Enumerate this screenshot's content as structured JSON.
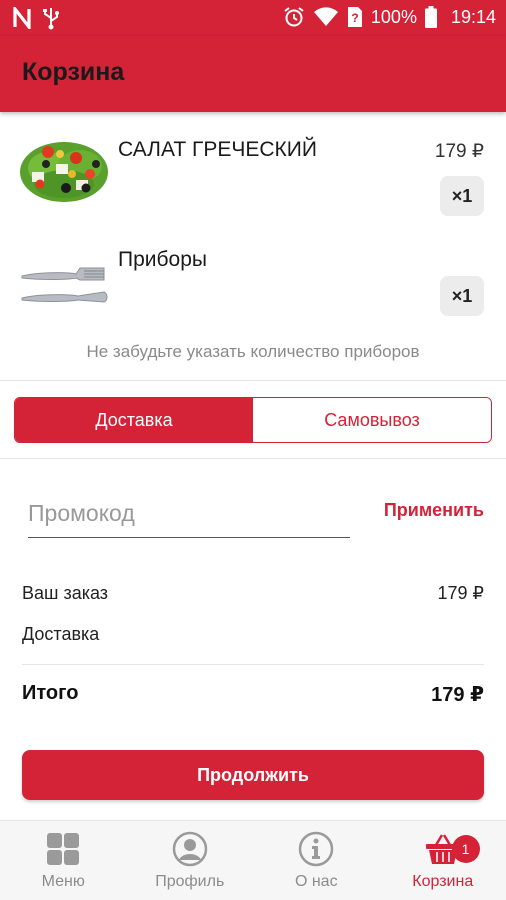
{
  "status_bar": {
    "battery_text": "100%",
    "time": "19:14",
    "icons": [
      "n-icon",
      "usb-icon",
      "alarm-icon",
      "wifi-icon",
      "sim-question-icon",
      "battery-icon"
    ]
  },
  "app_bar": {
    "title": "Корзина"
  },
  "cart_items": [
    {
      "name": "САЛАТ ГРЕЧЕСКИЙ",
      "price": "179 ₽",
      "qty": "×1",
      "image": "greek-salad-photo"
    },
    {
      "name": "Приборы",
      "price": "",
      "qty": "×1",
      "image": "cutlery-photo"
    }
  ],
  "hint": "Не забудьте указать количество приборов",
  "delivery_toggle": {
    "delivery": "Доставка",
    "pickup": "Самовывоз",
    "selected": "delivery"
  },
  "promo": {
    "placeholder": "Промокод",
    "apply": "Применить"
  },
  "summary": {
    "order_label": "Ваш заказ",
    "order_value": "179 ₽",
    "delivery_label": "Доставка",
    "delivery_value": "",
    "total_label": "Итого",
    "total_value": "179 ₽"
  },
  "continue_button": "Продолжить",
  "bottom_nav": [
    {
      "label": "Меню",
      "icon": "grid-icon",
      "active": false
    },
    {
      "label": "Профиль",
      "icon": "profile-icon",
      "active": false
    },
    {
      "label": "О нас",
      "icon": "info-icon",
      "active": false
    },
    {
      "label": "Корзина",
      "icon": "basket-icon",
      "active": true,
      "badge": "1"
    }
  ],
  "colors": {
    "accent": "#d42237",
    "muted_text": "#8a8a8a",
    "nav_bg": "#f6f6f6"
  }
}
